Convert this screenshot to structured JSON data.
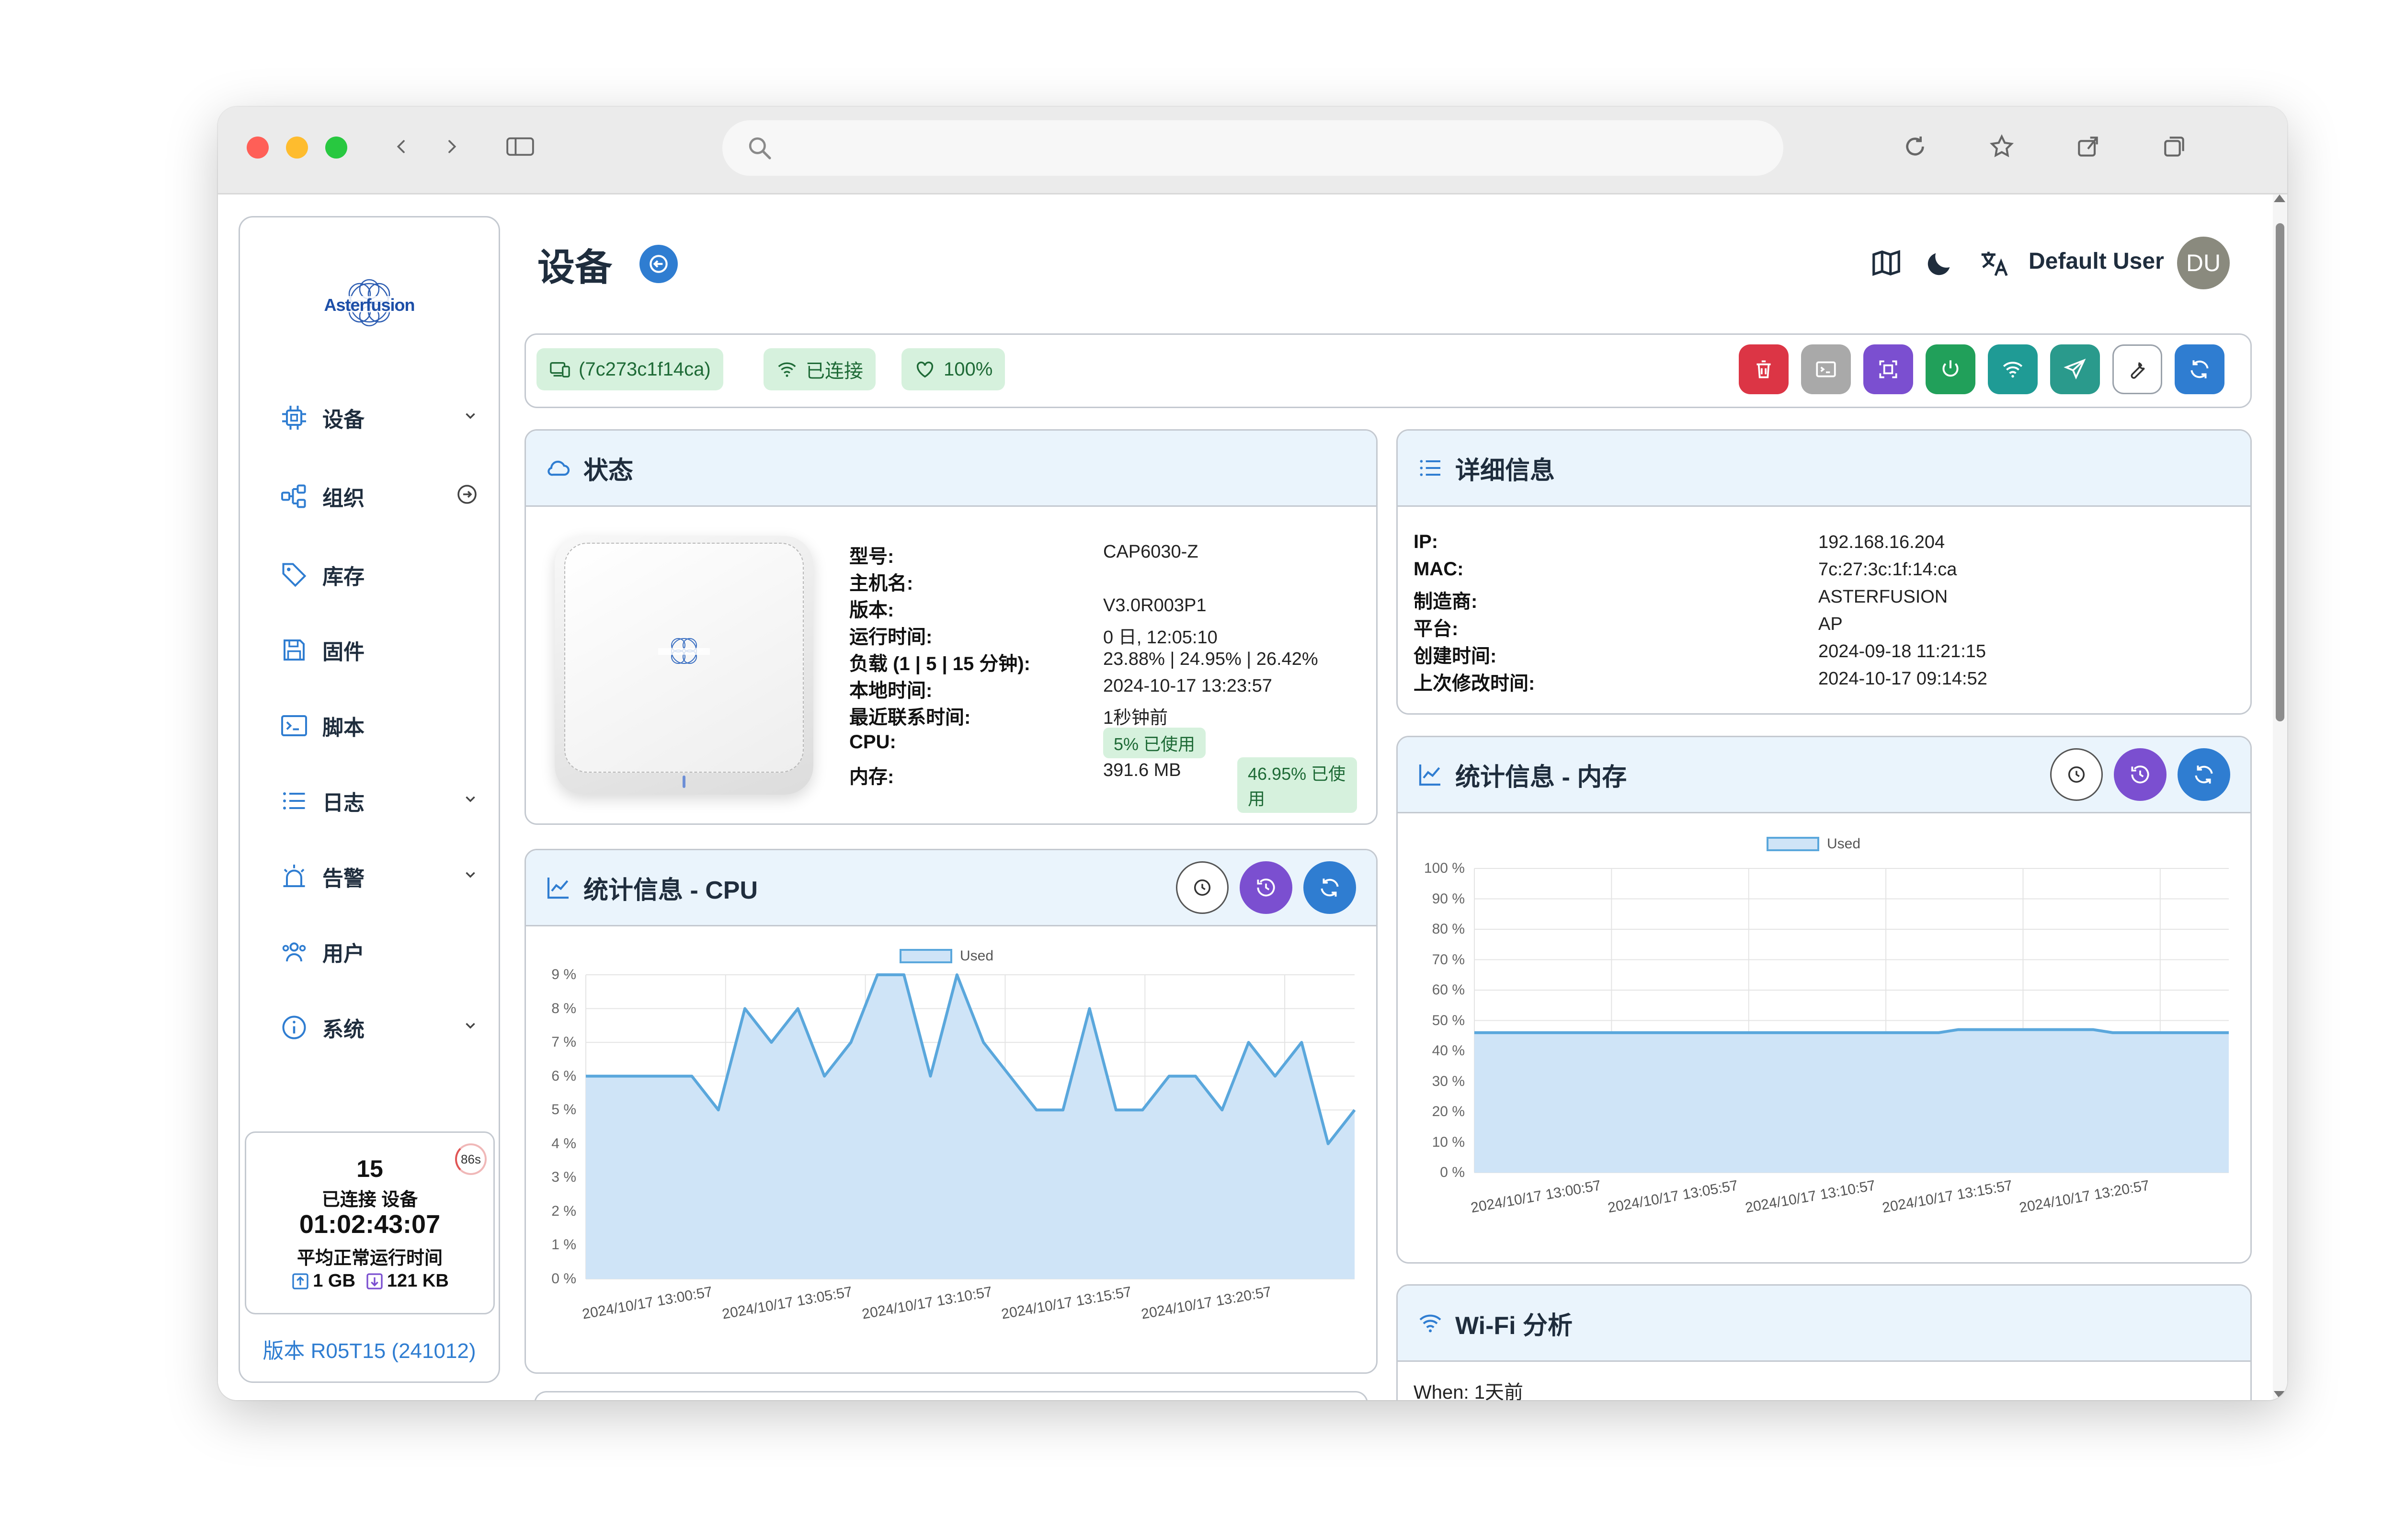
{
  "header": {
    "title": "设备",
    "user_name": "Default User",
    "avatar_initials": "DU"
  },
  "brand": {
    "logo_text": "Asterfusion"
  },
  "sidebar": {
    "items": [
      {
        "label": "设备",
        "icon": "chip-icon",
        "has_chevron": true
      },
      {
        "label": "组织",
        "icon": "hierarchy-icon",
        "has_arrow": true
      },
      {
        "label": "库存",
        "icon": "tag-icon"
      },
      {
        "label": "固件",
        "icon": "save-icon"
      },
      {
        "label": "脚本",
        "icon": "terminal-icon"
      },
      {
        "label": "日志",
        "icon": "list-icon",
        "has_chevron": true
      },
      {
        "label": "告警",
        "icon": "alarm-icon",
        "has_chevron": true
      },
      {
        "label": "用户",
        "icon": "users-icon"
      },
      {
        "label": "系统",
        "icon": "info-icon",
        "has_chevron": true
      }
    ],
    "stats": {
      "timer": "86s",
      "count": "15",
      "count_label": "已连接 设备",
      "uptime": "01:02:43:07",
      "uptime_label": "平均正常运行时间",
      "upload": "1 GB",
      "download": "121 KB"
    },
    "version": "版本 R05T15 (241012)"
  },
  "device_bar": {
    "serial": "(7c273c1f14ca)",
    "status": "已连接",
    "health": "100%"
  },
  "status_card": {
    "title": "状态",
    "rows": [
      {
        "label": "型号:",
        "value": "CAP6030-Z"
      },
      {
        "label": "主机名:",
        "value": ""
      },
      {
        "label": "版本:",
        "value": "V3.0R003P1"
      },
      {
        "label": "运行时间:",
        "value": "0 日, 12:05:10"
      },
      {
        "label": "负载 (1 | 5 | 15 分钟):",
        "value": "23.88% | 24.95% | 26.42%"
      },
      {
        "label": "本地时间:",
        "value": "2024-10-17 13:23:57"
      },
      {
        "label": "最近联系时间:",
        "value": "1秒钟前"
      }
    ],
    "cpu_label": "CPU:",
    "cpu_badge": "5% 已使用",
    "mem_label": "内存:",
    "mem_value": "391.6 MB",
    "mem_badge": "46.95% 已使用"
  },
  "details_card": {
    "title": "详细信息",
    "rows": [
      {
        "label": "IP:",
        "value": "192.168.16.204"
      },
      {
        "label": "MAC:",
        "value": "7c:27:3c:1f:14:ca"
      },
      {
        "label": "制造商:",
        "value": "ASTERFUSION"
      },
      {
        "label": "平台:",
        "value": "AP"
      },
      {
        "label": "创建时间:",
        "value": "2024-09-18 11:21:15"
      },
      {
        "label": "上次修改时间:",
        "value": "2024-10-17 09:14:52"
      }
    ]
  },
  "wifi_card": {
    "title": "Wi-Fi 分析",
    "when": "When: 1天前"
  },
  "chart_data": [
    {
      "type": "area",
      "title": "统计信息 - CPU",
      "series": [
        {
          "name": "Used",
          "values": [
            6,
            6,
            6,
            6,
            6,
            5,
            8,
            7,
            8,
            6,
            7,
            9,
            9,
            6,
            9,
            7,
            6,
            5,
            5,
            8,
            5,
            5,
            6,
            6,
            5,
            7,
            6,
            7,
            4,
            5
          ]
        }
      ],
      "x_ticks": [
        "2024/10/17 13:00:57",
        "2024/10/17 13:05:57",
        "2024/10/17 13:10:57",
        "2024/10/17 13:15:57",
        "2024/10/17 13:20:57"
      ],
      "y_ticks": [
        "9 %",
        "8 %",
        "7 %",
        "6 %",
        "5 %",
        "4 %",
        "3 %",
        "2 %",
        "1 %",
        "0 %"
      ],
      "ylim": [
        0,
        9
      ],
      "grid": true,
      "legend": "top-center",
      "color": "#5aa7dc",
      "fill": "#cfe4f7"
    },
    {
      "type": "area",
      "title": "统计信息 - 内存",
      "series": [
        {
          "name": "Used",
          "values": [
            46,
            46,
            46,
            46,
            46,
            46,
            46,
            46,
            46,
            46,
            46,
            46,
            46,
            46,
            46,
            46,
            46,
            46,
            46,
            46,
            46,
            46,
            46,
            46,
            46,
            47,
            47,
            47,
            47,
            47,
            47,
            47,
            47,
            46,
            46,
            46,
            46,
            46,
            46,
            46
          ]
        }
      ],
      "x_ticks": [
        "2024/10/17 13:00:57",
        "2024/10/17 13:05:57",
        "2024/10/17 13:10:57",
        "2024/10/17 13:15:57",
        "2024/10/17 13:20:57"
      ],
      "y_ticks": [
        "100 %",
        "90 %",
        "80 %",
        "70 %",
        "60 %",
        "50 %",
        "40 %",
        "30 %",
        "20 %",
        "10 %",
        "0 %"
      ],
      "ylim": [
        0,
        100
      ],
      "grid": true,
      "legend": "top-center",
      "color": "#5aa7dc",
      "fill": "#cfe4f7"
    }
  ],
  "colors": {
    "delete": "#dc3545",
    "terminal": "#a9a9a9",
    "scan": "#7b4fd0",
    "power": "#21a05a",
    "wifi": "#1f9b95",
    "send": "#2a9a8c",
    "refresh": "#2f7dd1"
  }
}
